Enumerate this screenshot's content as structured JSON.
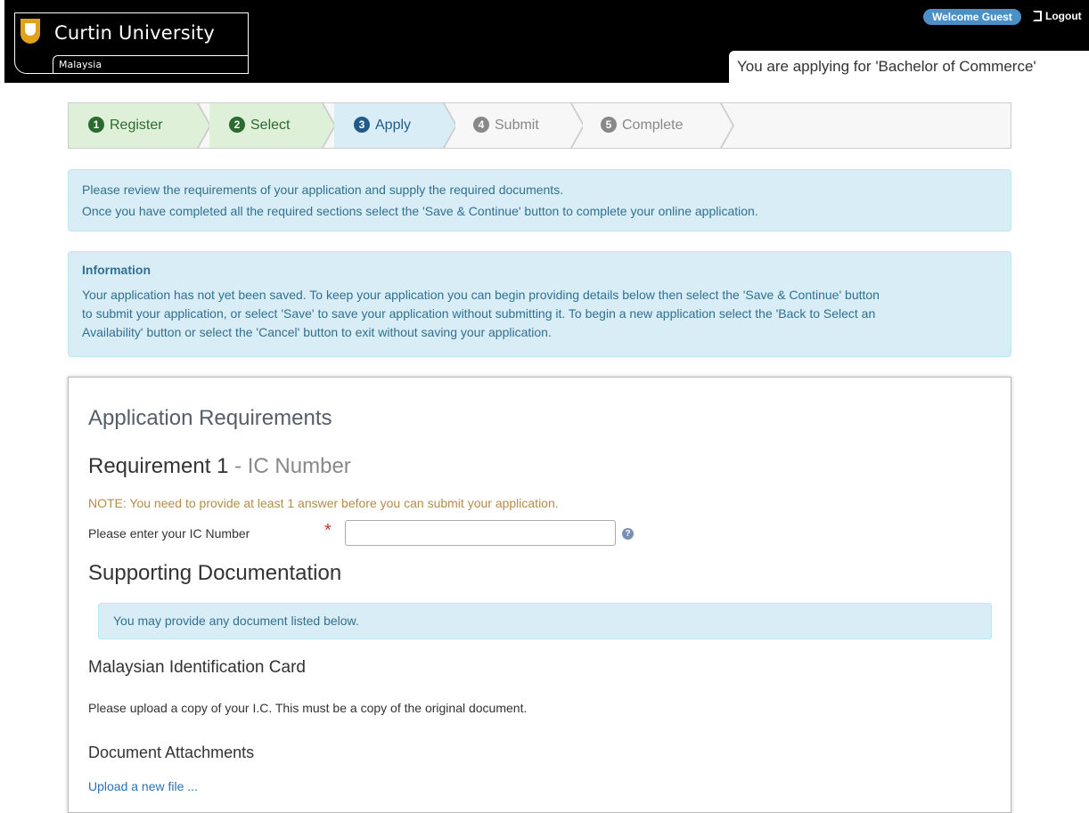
{
  "header": {
    "logo_name": "Curtin University",
    "logo_sub": "Malaysia",
    "welcome_badge": "Welcome Guest",
    "logout_label": "Logout",
    "applying_text": "You are applying for 'Bachelor of Commerce'"
  },
  "steps": [
    {
      "num": "1",
      "label": "Register",
      "state": "done"
    },
    {
      "num": "2",
      "label": "Select",
      "state": "done"
    },
    {
      "num": "3",
      "label": "Apply",
      "state": "active"
    },
    {
      "num": "4",
      "label": "Submit",
      "state": "todo"
    },
    {
      "num": "5",
      "label": "Complete",
      "state": "todo"
    }
  ],
  "instructions": {
    "line1": "Please review the requirements of your application and supply the required documents.",
    "line2": "Once you have completed all the required sections select the 'Save & Continue' button to complete your online application."
  },
  "information": {
    "title": "Information",
    "line1": "Your application has not yet been saved. To keep your application you can begin providing details below then select the 'Save & Continue' button",
    "line2": "to submit your application, or select 'Save' to save your application without submitting it. To begin a new application select the 'Back to Select an",
    "line3": "Availability' button or select the 'Cancel' button to exit without saving your application."
  },
  "requirements": {
    "heading": "Application Requirements",
    "req_title": "Requirement 1",
    "req_sep": " - ",
    "req_subtitle": "IC Number",
    "note": "NOTE: You need to provide at least 1 answer before you can submit your application.",
    "field_label": "Please enter your IC Number",
    "required_marker": "*",
    "field_value": "",
    "help_glyph": "?"
  },
  "supporting": {
    "heading": "Supporting Documentation",
    "notice": "You may provide any document listed below.",
    "doc_title": "Malaysian Identification Card",
    "doc_desc": "Please upload a copy of your I.C. This must be a copy of the original document.",
    "attachments_heading": "Document Attachments",
    "upload_link": "Upload a new file ..."
  },
  "colors": {
    "header_bg": "#000000",
    "logo_accent": "#e0a21d",
    "step_done": "#2c6b2f",
    "step_active": "#225b88",
    "info_bg": "#d9edf7",
    "info_text": "#31708f",
    "note_text": "#b58c4a",
    "link": "#2a72b5"
  }
}
